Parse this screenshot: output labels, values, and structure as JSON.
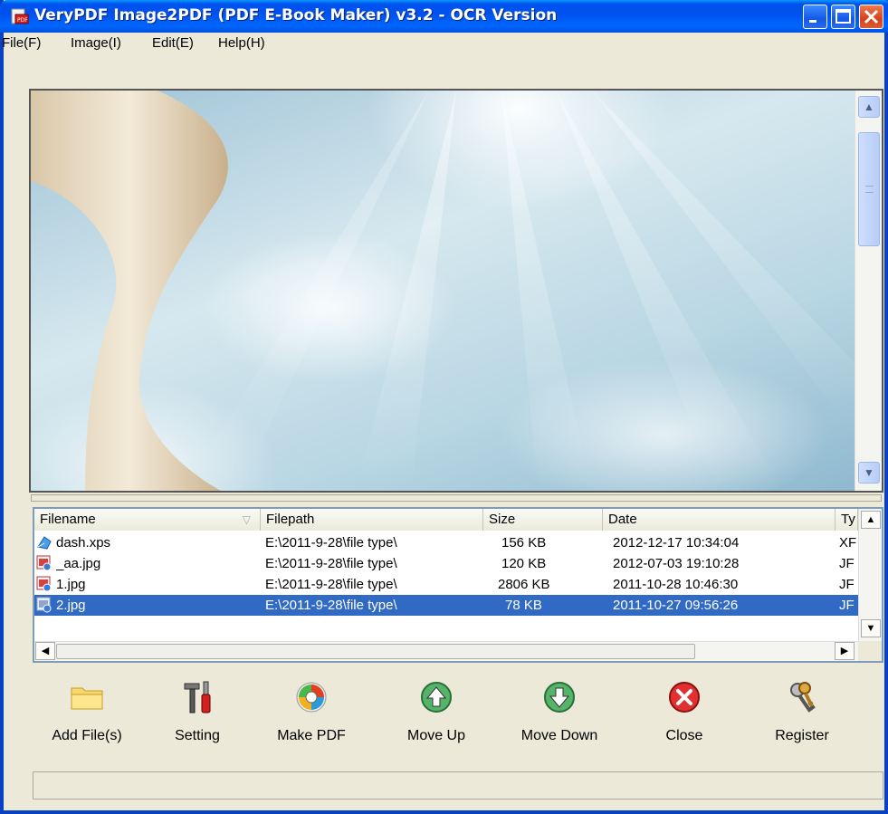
{
  "window": {
    "title": "VeryPDF Image2PDF (PDF E-Book Maker) v3.2 - OCR Version",
    "app_icon": "pdf-app-icon",
    "controls": [
      "minimize-icon",
      "maximize-icon",
      "close-icon"
    ]
  },
  "menu": {
    "items": [
      {
        "label": "File(F)"
      },
      {
        "label": "Image(I)"
      },
      {
        "label": "Edit(E)"
      },
      {
        "label": "Help(H)"
      }
    ]
  },
  "file_list": {
    "columns": [
      {
        "label": "Filename",
        "sort_icon": "▽"
      },
      {
        "label": "Filepath"
      },
      {
        "label": "Size"
      },
      {
        "label": "Date"
      },
      {
        "label": "Ty"
      }
    ],
    "rows": [
      {
        "icon": "xps-file-icon",
        "filename": "dash.xps",
        "filepath": "E:\\2011-9-28\\file type\\",
        "size": "156 KB",
        "date": "2012-12-17 10:34:04",
        "type": "XF",
        "selected": false
      },
      {
        "icon": "image-file-icon",
        "filename": "_aa.jpg",
        "filepath": "E:\\2011-9-28\\file type\\",
        "size": "120 KB",
        "date": "2012-07-03 19:10:28",
        "type": "JF",
        "selected": false
      },
      {
        "icon": "image-file-icon",
        "filename": "1.jpg",
        "filepath": "E:\\2011-9-28\\file type\\",
        "size": "2806 KB",
        "date": "2011-10-28 10:46:30",
        "type": "JF",
        "selected": false
      },
      {
        "icon": "image-file-icon",
        "filename": "2.jpg",
        "filepath": "E:\\2011-9-28\\file type\\",
        "size": "78 KB",
        "date": "2011-10-27 09:56:26",
        "type": "JF",
        "selected": true
      }
    ]
  },
  "toolbar": {
    "buttons": [
      {
        "label": "Add File(s)",
        "icon": "folder-icon"
      },
      {
        "label": "Setting",
        "icon": "tools-icon"
      },
      {
        "label": "Make PDF",
        "icon": "make-pdf-icon"
      },
      {
        "label": "Move Up",
        "icon": "arrow-up-circle-icon"
      },
      {
        "label": "Move Down",
        "icon": "arrow-down-circle-icon"
      },
      {
        "label": "Close",
        "icon": "close-circle-icon"
      },
      {
        "label": "Register",
        "icon": "keys-icon"
      }
    ]
  },
  "status": {
    "text": ""
  },
  "colors": {
    "titlebar": "#0053ee",
    "selection": "#316ac5",
    "window_bg": "#ece9d8"
  }
}
